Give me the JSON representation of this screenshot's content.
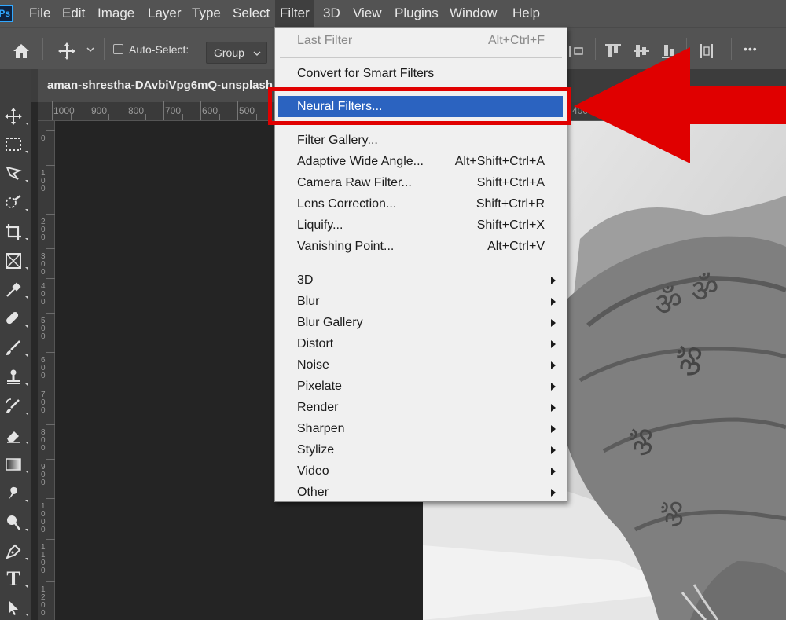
{
  "app": {
    "logo": "Ps"
  },
  "menubar": {
    "items": [
      "File",
      "Edit",
      "Image",
      "Layer",
      "Type",
      "Select",
      "Filter",
      "3D",
      "View",
      "Plugins",
      "Window",
      "Help"
    ],
    "active": "Filter"
  },
  "options": {
    "auto_select_label": "Auto-Select:",
    "auto_select_checked": false,
    "group_value": "Group",
    "more_glyph": "•••"
  },
  "document": {
    "tab_title": "aman-shrestha-DAvbiVpg6mQ-unsplash"
  },
  "ruler": {
    "h_labels": [
      "1000",
      "900",
      "800",
      "700",
      "600",
      "500",
      "400"
    ],
    "v_labels": [
      "0",
      "1 0 0",
      "2 0 0",
      "3 0 0",
      "4 0 0",
      "5 0 0",
      "6 0 0",
      "7 0 0",
      "8 0 0",
      "9 0 0",
      "1 0 0 0",
      "1 1 0 0",
      "1 2 0 0"
    ]
  },
  "filter_menu": {
    "last_filter": {
      "label": "Last Filter",
      "shortcut": "Alt+Ctrl+F",
      "disabled": true
    },
    "convert_smart": {
      "label": "Convert for Smart Filters"
    },
    "neural_filters": {
      "label": "Neural Filters...",
      "highlighted": true
    },
    "filter_gallery": {
      "label": "Filter Gallery..."
    },
    "adaptive_wide": {
      "label": "Adaptive Wide Angle...",
      "shortcut": "Alt+Shift+Ctrl+A"
    },
    "camera_raw": {
      "label": "Camera Raw Filter...",
      "shortcut": "Shift+Ctrl+A"
    },
    "lens_correction": {
      "label": "Lens Correction...",
      "shortcut": "Shift+Ctrl+R"
    },
    "liquify": {
      "label": "Liquify...",
      "shortcut": "Shift+Ctrl+X"
    },
    "vanishing_point": {
      "label": "Vanishing Point...",
      "shortcut": "Alt+Ctrl+V"
    },
    "submenus": [
      "3D",
      "Blur",
      "Blur Gallery",
      "Distort",
      "Noise",
      "Pixelate",
      "Render",
      "Sharpen",
      "Stylize",
      "Video",
      "Other"
    ]
  },
  "annotation": {
    "color": "#e00000",
    "target": "Neural Filters..."
  },
  "colors": {
    "menubar": "#535353",
    "toolbar": "#3e3e3e",
    "canvas": "#242424",
    "menu_bg": "#f0f0f0",
    "highlight": "#2b63c0"
  },
  "tools": [
    "move-tool",
    "marquee-tool",
    "lasso-tool",
    "quick-selection-tool",
    "crop-tool",
    "frame-tool",
    "eyedropper-tool",
    "spot-healing-tool",
    "brush-tool",
    "clone-stamp-tool",
    "history-brush-tool",
    "eraser-tool",
    "gradient-tool",
    "smudge-tool",
    "dodge-tool",
    "pen-tool",
    "type-tool",
    "path-selection-tool"
  ]
}
